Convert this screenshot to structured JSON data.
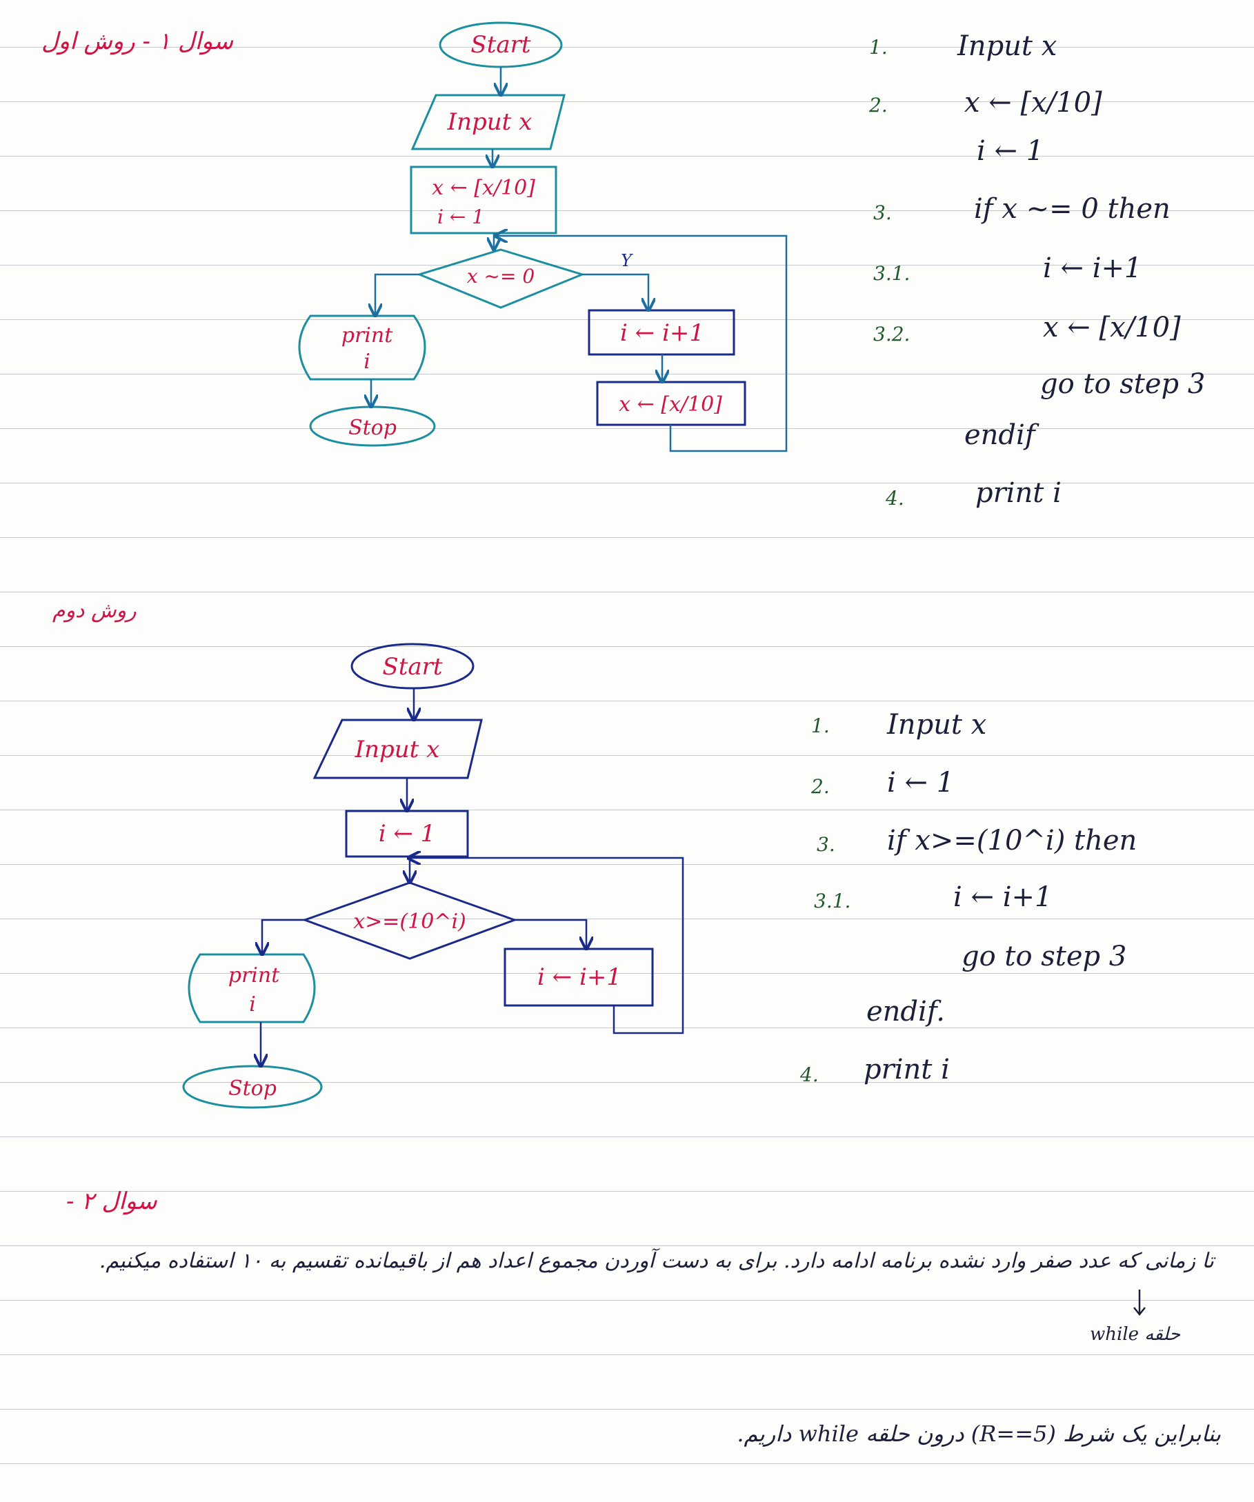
{
  "headings": {
    "q1": "سوال ۱ - روش اول",
    "method2": "روش دوم",
    "q2": "سوال ۲ -"
  },
  "flow1": {
    "start": "Start",
    "input": "Input x",
    "assign_x": "x ← [x/10]",
    "assign_i": "i ← 1",
    "condition": "x ~= 0",
    "yes_label": "Y",
    "inc": "i ← i+1",
    "update": "x ← [x/10]",
    "print": "print",
    "print_var": "i",
    "stop": "Stop"
  },
  "algo1": [
    {
      "num": "1.",
      "text": "Input   x"
    },
    {
      "num": "2.",
      "text": "x ← [x/10]"
    },
    {
      "num": "",
      "text": "i ← 1"
    },
    {
      "num": "3.",
      "text": "if   x ~= 0   then"
    },
    {
      "num": "3.1.",
      "text": "i ← i+1"
    },
    {
      "num": "3.2.",
      "text": "x ← [x/10]"
    },
    {
      "num": "",
      "text": "go to step 3"
    },
    {
      "num": "",
      "text": "endif"
    },
    {
      "num": "4.",
      "text": "print i"
    }
  ],
  "flow2": {
    "start": "Start",
    "input": "Input x",
    "assign_i": "i ← 1",
    "condition": "x>=(10^i)",
    "inc": "i ← i+1",
    "print": "print",
    "print_var": "i",
    "stop": "Stop"
  },
  "algo2": [
    {
      "num": "1.",
      "text": "Input   x"
    },
    {
      "num": "2.",
      "text": "i ← 1"
    },
    {
      "num": "3.",
      "text": "if   x>=(10^i)   then"
    },
    {
      "num": "3.1.",
      "text": "i ← i+1"
    },
    {
      "num": "",
      "text": "go to step 3"
    },
    {
      "num": "",
      "text": "endif."
    },
    {
      "num": "4.",
      "text": "print i"
    }
  ],
  "q2_text": {
    "line1": "تا زمانی که عدد صفر وارد نشده برنامه ادامه دارد. برای به دست آوردن مجموع اعداد هم از باقیمانده تقسیم به ۱۰ استفاده میکنیم.",
    "arrow_note": "حلقه while",
    "line2": "بنابراین یک شرط (R==5) درون حلقه while داریم."
  },
  "colors": {
    "ink_blue": "#1a2a8a",
    "teal": "#1b8fa0",
    "red": "#d01446",
    "green": "#1f5a2a"
  }
}
